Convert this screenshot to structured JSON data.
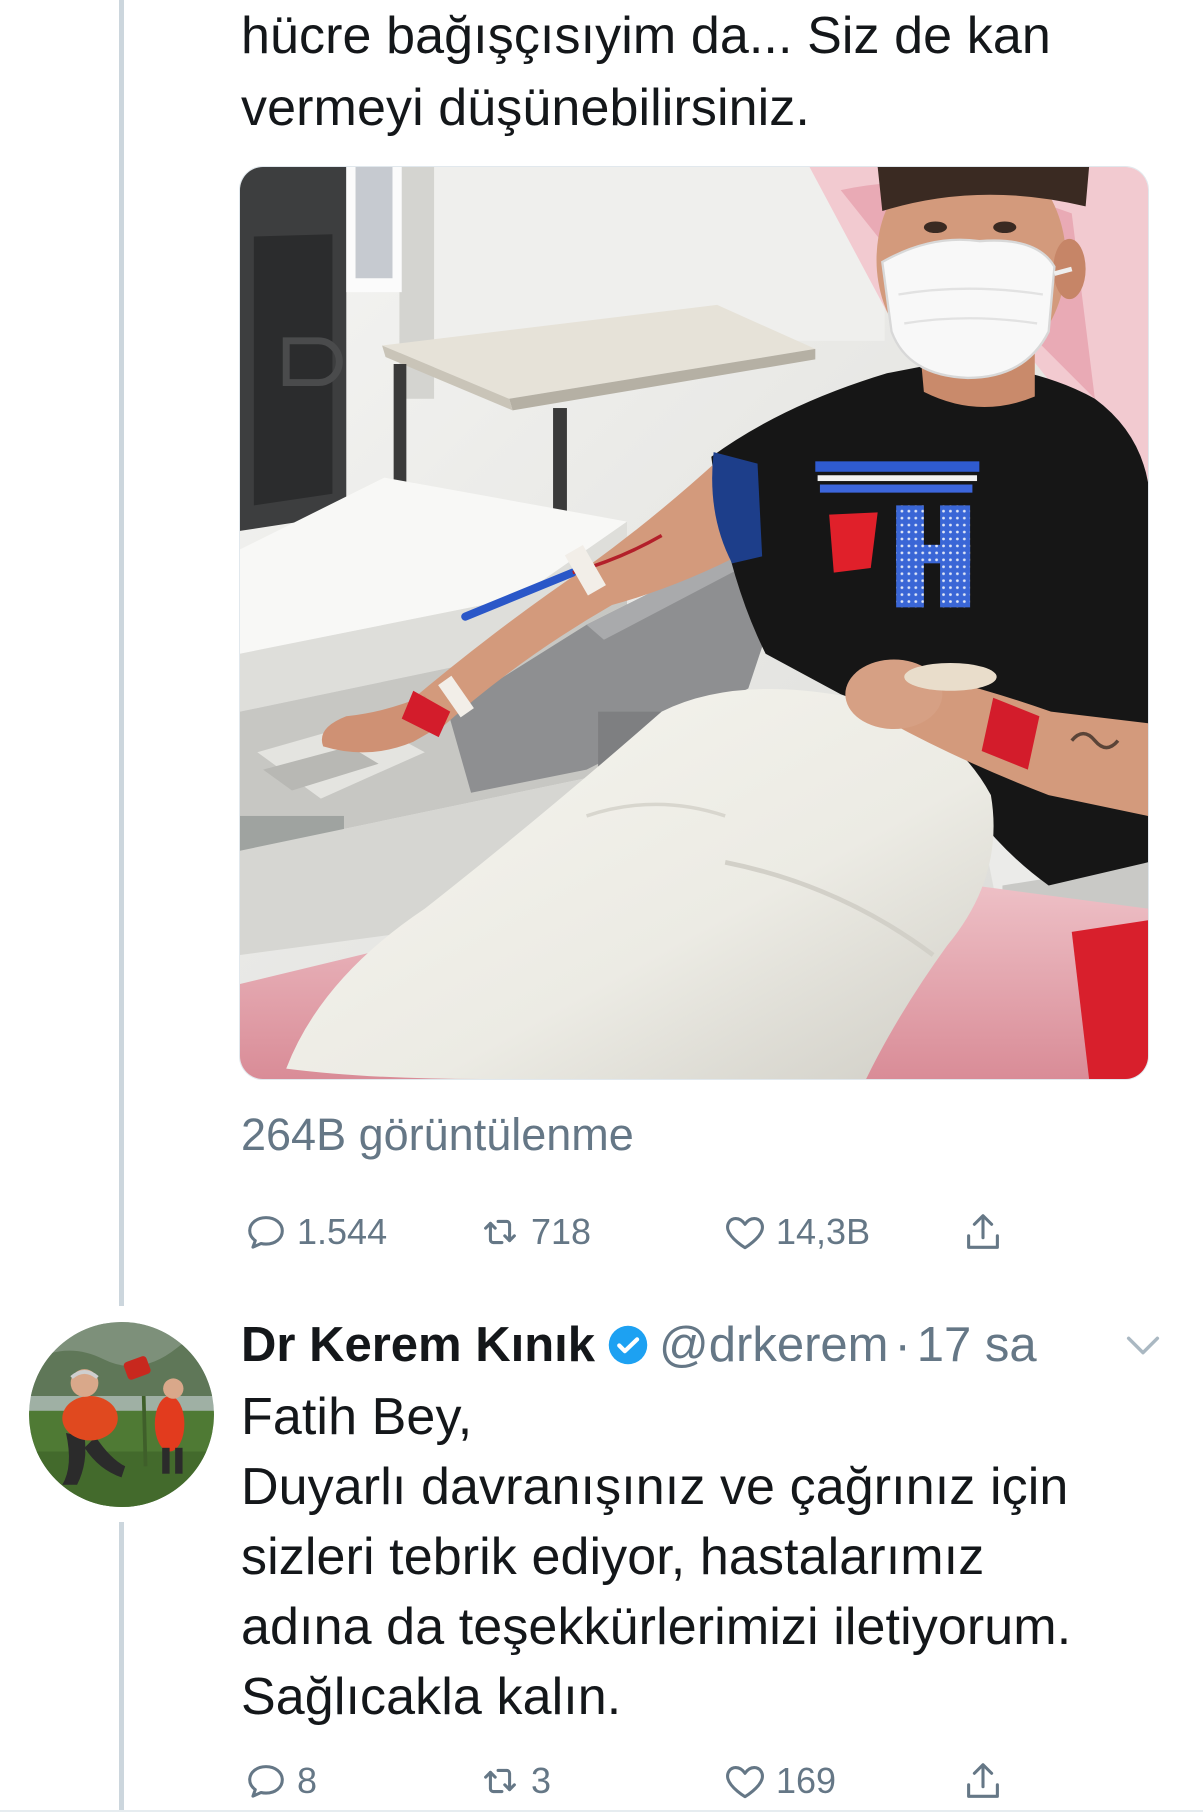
{
  "colors": {
    "accent": "#1da1f2",
    "text_primary": "#14171a",
    "text_secondary": "#657786",
    "thread_line": "#ccd6dd",
    "divider": "#e6ecf0"
  },
  "icons": {
    "reply": "reply-icon",
    "retweet": "retweet-icon",
    "like": "heart-icon",
    "share": "share-icon",
    "verified": "verified-badge-icon",
    "more": "chevron-down-icon"
  },
  "tweet": {
    "text_lines": [
      "hücre bağışçısıyim da... Siz de kan",
      "vermeyi düşünebilirsiniz."
    ],
    "view_count": "264B görüntülenme",
    "actions": {
      "reply_count": "1.544",
      "retweet_count": "718",
      "like_count": "14,3B"
    }
  },
  "reply": {
    "author": {
      "name": "Dr Kerem Kınık",
      "verified": true,
      "handle": "@drkerem"
    },
    "separator": "·",
    "time": "17 sa",
    "text_lines": [
      "Fatih Bey,",
      "Duyarlı davranışınız ve çağrınız için",
      "sizleri tebrik ediyor, hastalarımız",
      "adına da teşekkürlerimizi iletiyorum.",
      "Sağlıcakla kalın."
    ],
    "actions": {
      "reply_count": "8",
      "retweet_count": "3",
      "like_count": "169"
    }
  }
}
